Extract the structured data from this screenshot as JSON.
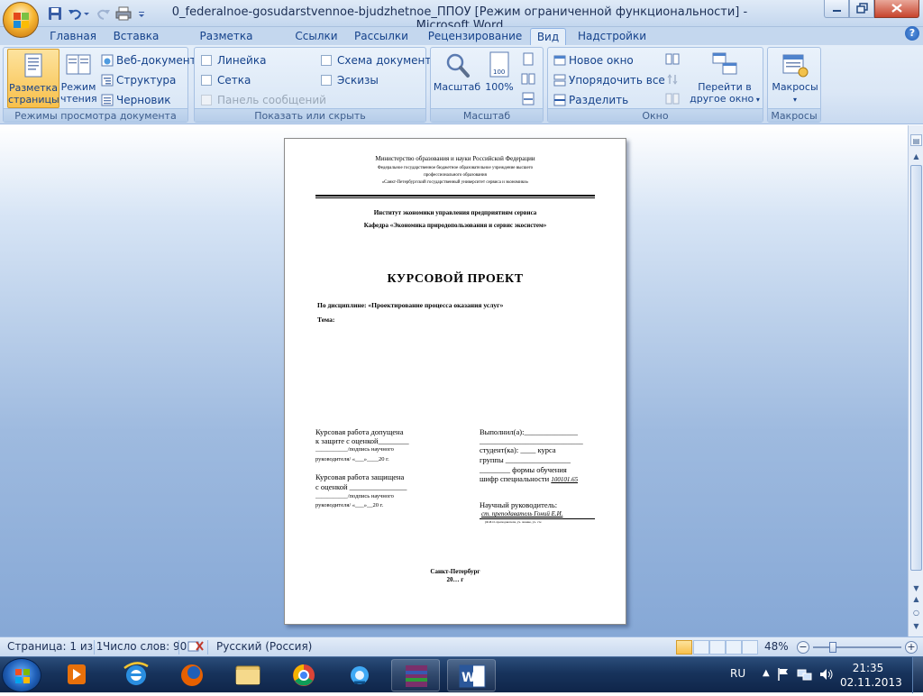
{
  "app": {
    "title": "0_federalnoe-gosudarstvennoe-bjudzhetnoe_ППОУ [Режим ограниченной функциональности] - Microsoft Word"
  },
  "tabs": [
    "Главная",
    "Вставка",
    "Разметка страницы",
    "Ссылки",
    "Рассылки",
    "Рецензирование",
    "Вид",
    "Надстройки"
  ],
  "active_tab": "Вид",
  "ribbon": {
    "views": {
      "label": "Режимы просмотра документа",
      "print_layout": "Разметка\nстраницы",
      "reading": "Режим\nчтения",
      "web": "Веб-документ",
      "outline": "Структура",
      "draft": "Черновик"
    },
    "show": {
      "label": "Показать или скрыть",
      "ruler": "Линейка",
      "grid": "Сетка",
      "message_bar": "Панель сообщений",
      "doc_map": "Схема документа",
      "thumbnails": "Эскизы"
    },
    "zoom": {
      "label": "Масштаб",
      "zoom_btn": "Масштаб",
      "hundred": "100%"
    },
    "window": {
      "label": "Окно",
      "new_window": "Новое окно",
      "arrange_all": "Упорядочить все",
      "split": "Разделить",
      "switch": "Перейти в\nдругое окно"
    },
    "macros": {
      "label": "Макросы",
      "btn": "Макросы"
    }
  },
  "document": {
    "ministry": "Министерство образования и науки Российской Федерации",
    "org1": "Федеральное государственное бюджетное образовательное учреждение высшего",
    "org2": "профессионального образования",
    "org3": "«Санкт-Петербургский государственный университет сервиса и экономики»",
    "institute": "Институт экономики управления предприятиям сервиса",
    "department": "Кафедра «Экономика природопользования и сервис экосистем»",
    "heading": "КУРСОВОЙ ПРОЕКТ",
    "discipline": "По дисциплине: «Проектирование процесса оказания услуг»",
    "topic": "Тема:",
    "left1": "Курсовая работа допущена",
    "left2": "к защите с оценкой________",
    "left3": "___________/подпись научного",
    "left4": "руководителя/ «___»____20    г.",
    "left5": "Курсовая работа защищена",
    "left6": "с оценкой _______________",
    "left7": "___________/подпись научного",
    "left8": "руководителя/ «___»__20     г.",
    "right1": "Выполнил(а):______________",
    "right2": "___________________________",
    "right3": "студент(ка): ____ курса",
    "right4": "группы _________________",
    "right5": "________ формы обучения",
    "right6": "шифр специальности ",
    "right6b": "100101.65",
    "right7": "Научный руководитель:",
    "right8": "ст. преподаватель Гоний Е.И.",
    "right9": "(Ф.И.О. преподавателя, уч. звание, уч. сте",
    "city": "Санкт-Петербург",
    "year": "20… г"
  },
  "status": {
    "page": "Страница: 1 из 1",
    "words": "Число слов: 90",
    "language": "Русский (Россия)",
    "zoom": "48%"
  },
  "taskbar": {
    "lang": "RU",
    "time": "21:35",
    "date": "02.11.2013"
  },
  "colors": {
    "ribbon_text": "#15428b",
    "active_view": "#f8c04b",
    "workspace_bottom": "#86a8d6",
    "taskbar": "#17335c"
  }
}
